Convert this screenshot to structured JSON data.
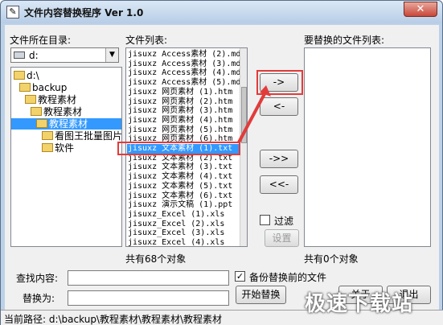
{
  "window": {
    "title": "文件内容替换程序 Ver 1.0",
    "close_label": "✕"
  },
  "left": {
    "dir_label": "文件所在目录:",
    "drive_value": "d:",
    "tree": [
      {
        "label": "d:\\",
        "indent": 0,
        "selected": false
      },
      {
        "label": "backup",
        "indent": 1,
        "selected": false
      },
      {
        "label": "教程素材",
        "indent": 2,
        "selected": false
      },
      {
        "label": "教程素材",
        "indent": 3,
        "selected": false
      },
      {
        "label": "教程素材",
        "indent": 4,
        "selected": true
      },
      {
        "label": "看图王批量图片转",
        "indent": 5,
        "selected": false
      },
      {
        "label": "软件",
        "indent": 5,
        "selected": false
      }
    ]
  },
  "middle": {
    "list_label": "文件列表:",
    "files": [
      "jisuxz Access素材 (2).md",
      "jisuxz Access素材 (3).md",
      "jisuxz Access素材 (4).md",
      "jisuxz Access素材 (5).md",
      "jisuxz 网页素材 (1).htm",
      "jisuxz 网页素材 (2).htm",
      "jisuxz 网页素材 (3).htm",
      "jisuxz 网页素材 (4).htm",
      "jisuxz 网页素材 (5).htm",
      "jisuxz 网页素材 (6).htm",
      "jisuxz 文本素材 (1).txt",
      "jisuxz 文本素材 (2).txt",
      "jisuxz 文本素材 (3).txt",
      "jisuxz 文本素材 (4).txt",
      "jisuxz 文本素材 (5).txt",
      "jisuxz 文本素材 (6).txt",
      "jisuxz 演示文稿 (1).ppt",
      "jisuxz_Excel (1).xls",
      "jisuxz_Excel (2).xls",
      "jisuxz_Excel (3).xls",
      "jisuxz_Excel (4).xls"
    ],
    "selected_index": 10,
    "count_text": "共有68个对象"
  },
  "buttons": {
    "add_one": "->",
    "remove_one": "<-",
    "add_all": "->>",
    "remove_all": "<<-",
    "filter_label": "过滤",
    "settings": "设置",
    "start_replace": "开始替换",
    "about": "关于",
    "exit": "退出"
  },
  "right": {
    "list_label": "要替换的文件列表:",
    "count_text": "共有0个对象"
  },
  "bottom": {
    "find_label": "查找内容:",
    "find_value": "",
    "replace_label": "替换为:",
    "replace_value": "",
    "backup_label": "备份替换前的文件",
    "backup_checked": "✓"
  },
  "status": {
    "path_text": "当前路径: d:\\backup\\教程素材\\教程素材\\教程素材"
  },
  "watermark": "极速下载站",
  "colors": {
    "selection": "#3399ff",
    "highlight": "#e23b3b"
  }
}
